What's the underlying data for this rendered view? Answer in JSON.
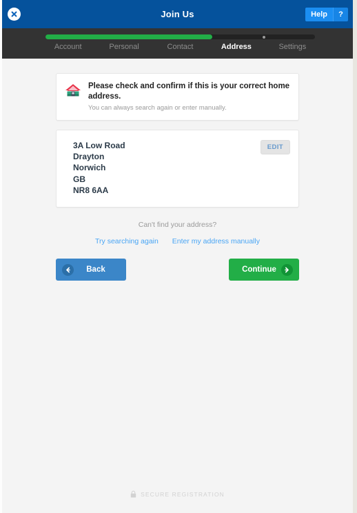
{
  "header": {
    "title": "Join Us",
    "close_icon": "close-circle-icon",
    "help_label": "Help",
    "help_question_label": "?"
  },
  "stepper": {
    "steps": [
      {
        "label": "Account",
        "active": false
      },
      {
        "label": "Personal",
        "active": false
      },
      {
        "label": "Contact",
        "active": false
      },
      {
        "label": "Address",
        "active": true
      },
      {
        "label": "Settings",
        "active": false
      }
    ],
    "progress_percent": 62,
    "marker_percent": 80.5,
    "fill_color": "#22ae47",
    "track_color": "#222222",
    "background_color": "#333333"
  },
  "alert": {
    "icon": "house-icon",
    "title": "Please check and confirm if this is your correct home address.",
    "subtitle": "You can always search again or enter manually."
  },
  "address_card": {
    "lines": [
      "3A Low Road",
      "Drayton",
      "Norwich",
      "GB",
      "NR8 6AA"
    ],
    "edit_label": "EDIT"
  },
  "help_section": {
    "prompt": "Can't find your address?",
    "link_search_again": "Try searching again",
    "link_manual": "Enter my address manually"
  },
  "actions": {
    "back_label": "Back",
    "back_icon": "arrow-left-icon",
    "back_color": "#3b86c8",
    "continue_label": "Continue",
    "continue_icon": "arrow-right-icon",
    "continue_color": "#22ae47"
  },
  "footer": {
    "icon": "lock-icon",
    "text": "SECURE REGISTRATION"
  }
}
